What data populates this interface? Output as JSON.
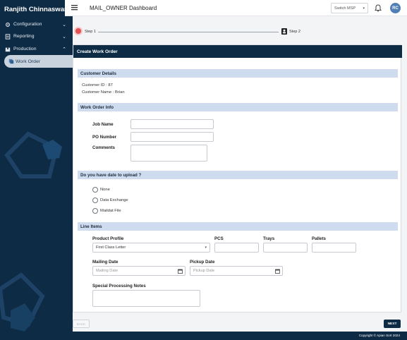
{
  "sidebar": {
    "user_name": "Ranjith Chinnaswamy",
    "items": [
      {
        "label": "Configuration",
        "icon": "gear-icon"
      },
      {
        "label": "Reporting",
        "icon": "report-icon"
      },
      {
        "label": "Production",
        "icon": "box-icon"
      }
    ],
    "sub_item": {
      "label": "Work Order",
      "icon": "workorder-icon"
    }
  },
  "header": {
    "title": "MAIL_OWNER Dashboard",
    "msp_placeholder": "Switch MSP",
    "avatar": "RC"
  },
  "stepper": {
    "step1": "Step 1",
    "step2": "Step 2"
  },
  "card": {
    "title": "Create Work Order",
    "customer": {
      "section": "Customer Details",
      "id_line": "Customer ID : 87",
      "name_line": "Customer Name : Brian"
    },
    "workorder": {
      "section": "Work Order Info",
      "job_name": "Job Name",
      "po_number": "PO Number",
      "comments": "Comments"
    },
    "upload": {
      "section": "Do you have date to upload ?",
      "options": [
        "None",
        "Data Exchange",
        "Maildat File"
      ]
    },
    "line_items": {
      "section": "Line Items",
      "product_profile": "Product Profile",
      "product_value": "First Class Letter",
      "pcs": "PCS",
      "trays": "Trays",
      "pallets": "Pallets",
      "mailing_date": "Mailing Date",
      "mailing_placeholder": "Mailing Date",
      "pickup_date": "Pickup Date",
      "pickup_placeholder": "Pickup Date",
      "notes": "Special Processing Notes"
    }
  },
  "buttons": {
    "back": "BACK",
    "next": "NEXT"
  },
  "footer": {
    "text": "Copyright © Apian Sort 2024"
  },
  "colors": {
    "navy": "#0d2b45",
    "section": "#cfdcf0",
    "accent_red": "#e35252",
    "avatar": "#4f7fb5"
  }
}
